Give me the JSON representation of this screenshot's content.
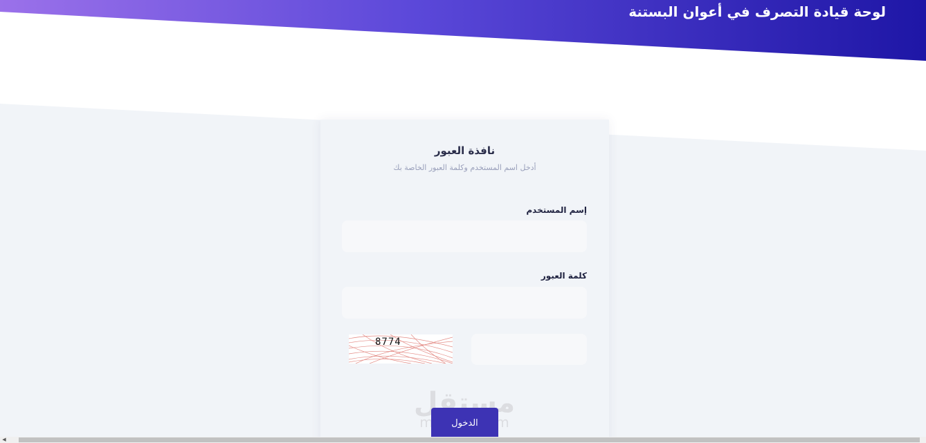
{
  "header": {
    "title": "لوحة قيادة التصرف في أعوان البستنة"
  },
  "login": {
    "title": "نافذة العبور",
    "subtitle": "أدخل اسم المستخدم وكلمة العبور الخاصة بك",
    "username_label": "إسم المستخدم",
    "username_value": "",
    "password_label": "كلمة العبور",
    "password_value": "",
    "captcha_code": "8774",
    "captcha_value": "",
    "submit_label": "الدخول"
  },
  "watermark": {
    "logo": "مستقل",
    "url": "mostaql.com"
  },
  "icons": {
    "scroll_left": "scroll-left-arrow-icon"
  },
  "colors": {
    "header_gradient_start": "#9b71ea",
    "header_gradient_end": "#1e16a6",
    "page_background": "#f1f4f8",
    "button": "#3d33b4",
    "label_text": "#1f2240",
    "subtitle_text": "#9aa0bb"
  }
}
